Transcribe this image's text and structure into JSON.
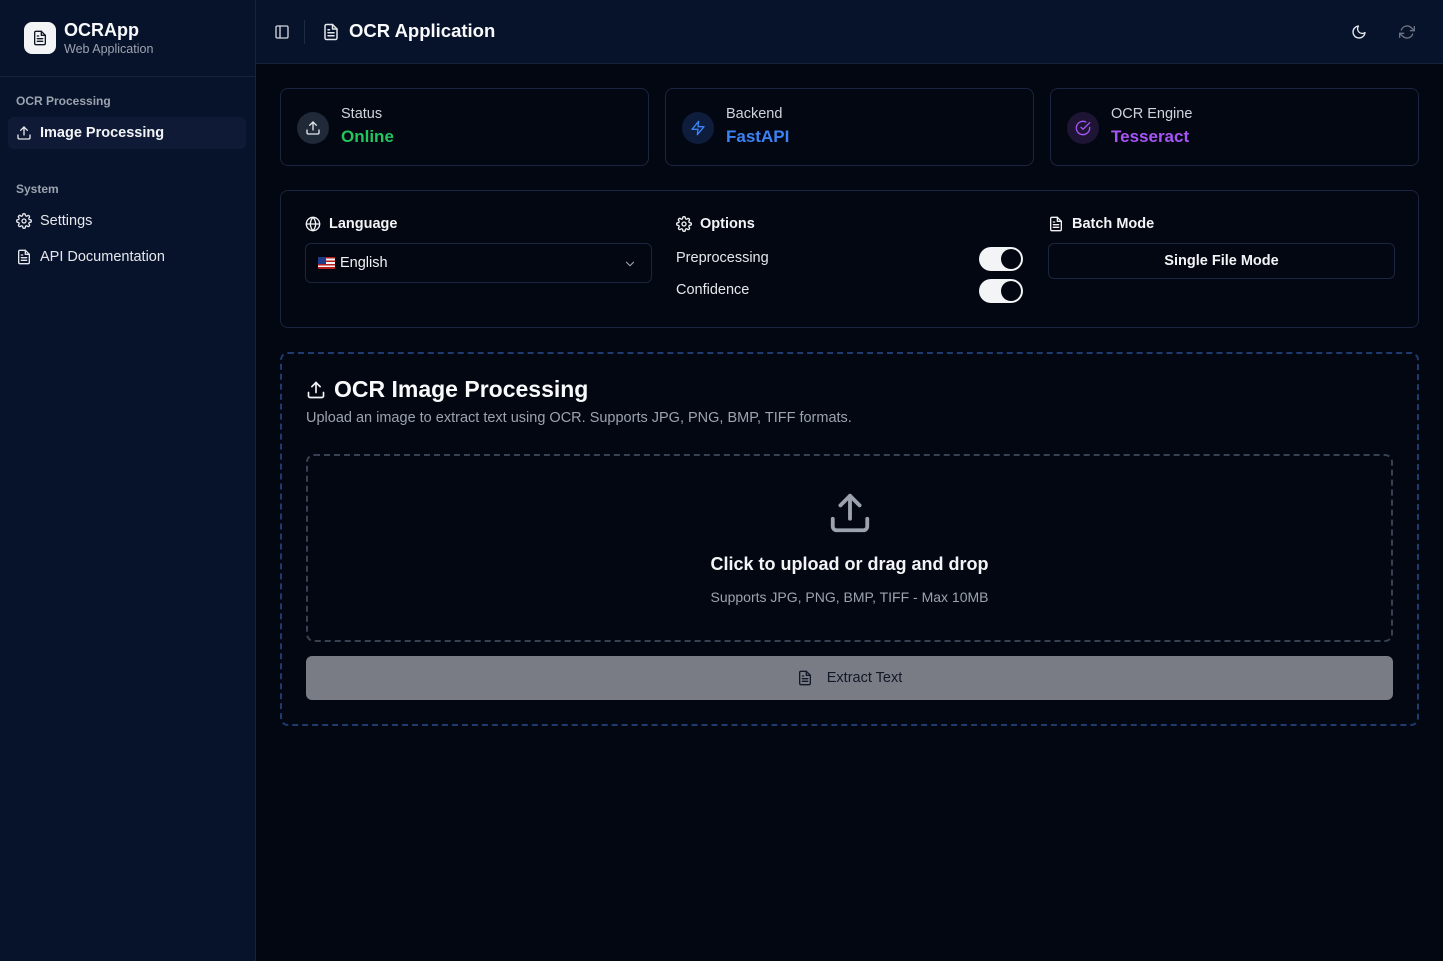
{
  "sidebar": {
    "app_name": "OCRApp",
    "app_subtitle": "Web Application",
    "groups": [
      {
        "label": "OCR Processing",
        "items": [
          {
            "label": "Image Processing",
            "icon": "upload-icon",
            "active": true
          }
        ]
      },
      {
        "label": "System",
        "items": [
          {
            "label": "Settings",
            "icon": "gear-icon"
          },
          {
            "label": "API Documentation",
            "icon": "document-icon"
          }
        ]
      }
    ]
  },
  "header": {
    "title": "OCR Application",
    "icons": [
      "sidebar-toggle-icon",
      "document-icon",
      "moon-icon",
      "refresh-icon"
    ]
  },
  "stats": [
    {
      "label": "Status",
      "value": "Online",
      "icon": "upload-icon",
      "color": "#22c55e"
    },
    {
      "label": "Backend",
      "value": "FastAPI",
      "icon": "lightning-icon",
      "color": "#3b82f6"
    },
    {
      "label": "OCR Engine",
      "value": "Tesseract",
      "icon": "check-circle-icon",
      "color": "#a855f7"
    }
  ],
  "options_panel": {
    "language": {
      "title": "Language",
      "selected": "English",
      "flag": "us-flag-icon"
    },
    "options": {
      "title": "Options",
      "toggles": [
        {
          "label": "Preprocessing",
          "enabled": true
        },
        {
          "label": "Confidence",
          "enabled": true
        }
      ]
    },
    "batch": {
      "title": "Batch Mode",
      "button_label": "Single File Mode"
    }
  },
  "main": {
    "title": "OCR Image Processing",
    "description": "Upload an image to extract text using OCR. Supports JPG, PNG, BMP, TIFF formats.",
    "dropzone": {
      "title": "Click to upload or drag and drop",
      "subtitle": "Supports JPG, PNG, BMP, TIFF - Max 10MB"
    },
    "extract_button": "Extract Text"
  }
}
